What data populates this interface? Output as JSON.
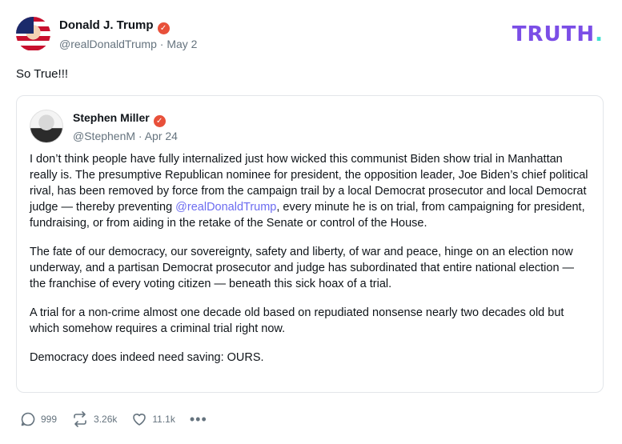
{
  "post": {
    "author_name": "Donald J. Trump",
    "handle": "@realDonaldTrump",
    "date": "May 2",
    "text": "So True!!!"
  },
  "brand": {
    "text": "TRUTH",
    "dot": "."
  },
  "quote": {
    "author_name": "Stephen Miller",
    "handle": "@StephenM",
    "date": "Apr 24",
    "p1_before": "I don’t think people have fully internalized just how wicked this communist Biden show trial in Manhattan really is. The presumptive Republican nominee for president, the opposition leader, Joe Biden’s chief political rival, has been removed by force from the campaign trail by a local Democrat prosecutor and local Democrat judge — thereby preventing ",
    "p1_mention": "@realDonaldTrump",
    "p1_after": ", every minute he is on trial, from campaigning for president, fundraising, or from aiding in the retake of the Senate or control of the House.",
    "p2": "The fate of our democracy, our sovereignty, safety and liberty, of war and peace, hinge on an election now underway, and a partisan Democrat prosecutor and judge has subordinated that entire national election — the franchise of every voting citizen — beneath this sick hoax of a trial.",
    "p3": "A trial for a non-crime almost one decade old based on repudiated nonsense nearly two decades old but which somehow requires a criminal trial right now.",
    "p4": "Democracy does indeed need saving: OURS."
  },
  "actions": {
    "replies": "999",
    "retruths": "3.26k",
    "likes": "11.1k",
    "more": "•••"
  },
  "colors": {
    "brand": "#7b4ee6",
    "brand_dot": "#3fe0d0",
    "verified": "#e8503a",
    "mention": "#6c6cf0"
  },
  "icons": [
    "verified-badge-icon",
    "reply-icon",
    "retruth-icon",
    "like-icon",
    "more-icon"
  ]
}
